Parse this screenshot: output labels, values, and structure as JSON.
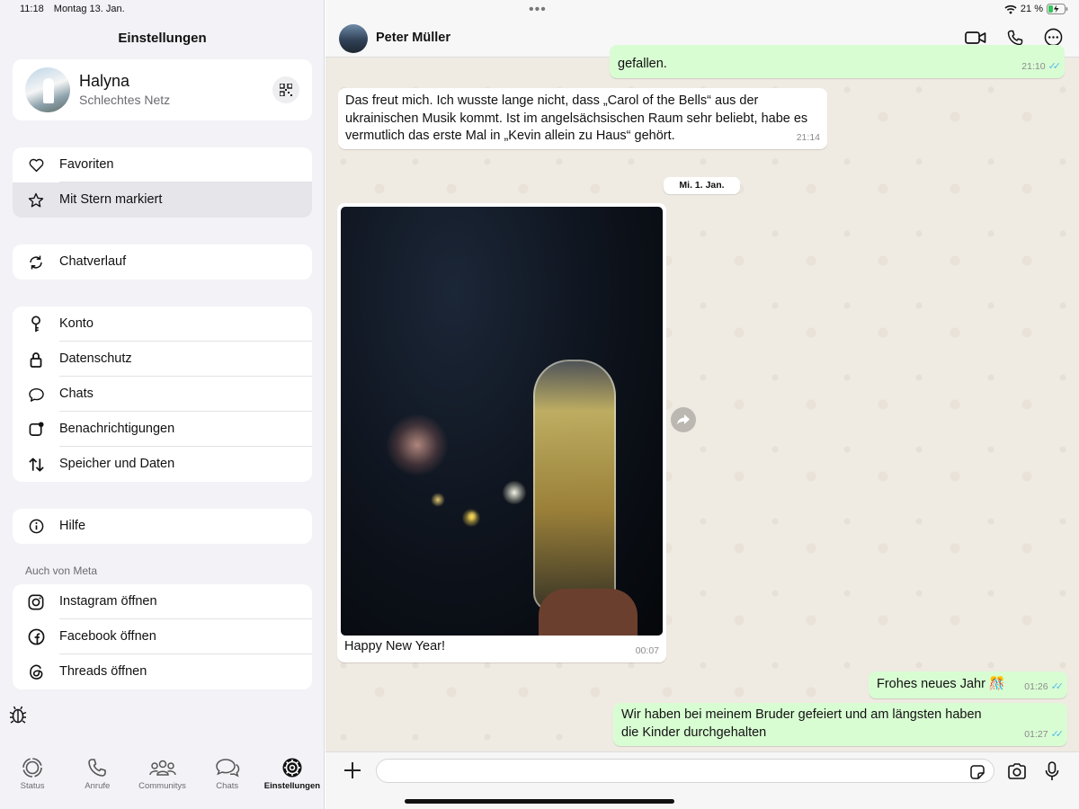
{
  "status_bar": {
    "time": "11:18",
    "date": "Montag 13. Jan.",
    "battery": "21 %"
  },
  "settings": {
    "title": "Einstellungen",
    "profile": {
      "name": "Halyna",
      "status": "Schlechtes Netz"
    },
    "group1": [
      {
        "label": "Favoriten",
        "icon": "heart-icon"
      },
      {
        "label": "Mit Stern markiert",
        "icon": "star-icon"
      }
    ],
    "group2": [
      {
        "label": "Chatverlauf",
        "icon": "sync-icon"
      }
    ],
    "group3": [
      {
        "label": "Konto",
        "icon": "key-icon"
      },
      {
        "label": "Datenschutz",
        "icon": "lock-icon"
      },
      {
        "label": "Chats",
        "icon": "chat-bubble-icon"
      },
      {
        "label": "Benachrichtigungen",
        "icon": "notification-icon"
      },
      {
        "label": "Speicher und Daten",
        "icon": "arrows-updown-icon"
      }
    ],
    "group4": [
      {
        "label": "Hilfe",
        "icon": "info-icon"
      }
    ],
    "meta_section_title": "Auch von Meta",
    "group5": [
      {
        "label": "Instagram öffnen",
        "icon": "instagram-icon"
      },
      {
        "label": "Facebook öffnen",
        "icon": "facebook-icon"
      },
      {
        "label": "Threads öffnen",
        "icon": "threads-icon"
      }
    ]
  },
  "tabbar": {
    "tabs": [
      {
        "label": "Status",
        "icon": "status-icon"
      },
      {
        "label": "Anrufe",
        "icon": "phone-icon"
      },
      {
        "label": "Communitys",
        "icon": "communities-icon"
      },
      {
        "label": "Chats",
        "icon": "chats-icon"
      },
      {
        "label": "Einstellungen",
        "icon": "settings-gear-icon",
        "active": true
      }
    ]
  },
  "chat": {
    "contact_name": "Peter Müller",
    "messages": [
      {
        "direction": "out",
        "text": "gefallen.",
        "time": "21:10",
        "read": true
      },
      {
        "direction": "in",
        "text": "Das freut mich. Ich wusste lange nicht, dass „Carol of the Bells“ aus der ukrainischen Musik kommt. Ist im angelsächsischen Raum sehr beliebt, habe es vermutlich das erste Mal in „Kevin allein zu Haus“ gehört.",
        "time": "21:14"
      },
      {
        "type": "date",
        "text": "Mi. 1. Jan."
      },
      {
        "direction": "in",
        "type": "image",
        "caption": "Happy New Year!",
        "time": "00:07"
      },
      {
        "direction": "out",
        "text": "Frohes neues Jahr 🎊",
        "time": "01:26",
        "read": true
      },
      {
        "direction": "out",
        "text": "Wir haben bei meinem Bruder gefeiert und am längsten haben die Kinder durchgehalten",
        "time": "01:27",
        "read": true
      }
    ],
    "composer": {
      "value": "",
      "placeholder": ""
    }
  },
  "colors": {
    "outgoing_bubble": "#d9fdd3",
    "incoming_bubble": "#ffffff",
    "read_ticks": "#53bdeb",
    "chat_background": "#efeae2"
  }
}
